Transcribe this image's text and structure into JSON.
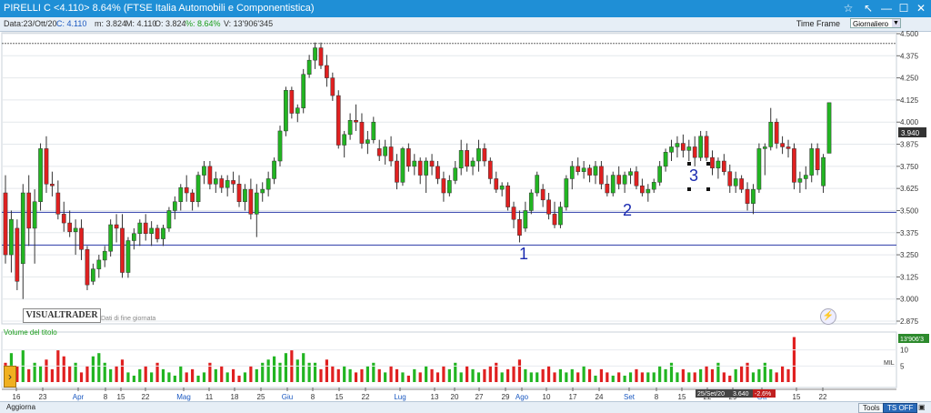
{
  "window": {
    "title": "PIRELLI C <4.110> 8.64%  (FTSE Italia Automobili e Componentistica)",
    "controls": [
      "☆",
      "↖",
      "—",
      "☐",
      "✕"
    ]
  },
  "infobar": {
    "date": "Data:23/Ott/20",
    "close": "C: 4.110",
    "min": "m: 3.824",
    "max": "M: 4.110",
    "open": "O: 3.824",
    "pct": "%: 8.64%",
    "volume": "V: 13'906'345"
  },
  "timeframe": {
    "label": "Time Frame",
    "value": "Giornaliero"
  },
  "logo": {
    "text": "VISUALTRADER",
    "subtitle": "Dati di fine giornata"
  },
  "price_tag": "3.940",
  "volume_tag": "13'906'3",
  "annotations": {
    "n1": "1",
    "n2": "2",
    "n3": "3"
  },
  "tooltip": {
    "date": "25/Set/20",
    "value": "3.640",
    "pct": "-2.6%"
  },
  "bottom": {
    "update_label": "Aggiorna",
    "tools_label": "Tools",
    "tsoff_label": "TS OFF"
  },
  "volume_panel": {
    "title": "Volume del titolo",
    "unit": "MIL"
  },
  "colors": {
    "up": "#22b522",
    "down": "#e02020",
    "title_bg": "#1f8fd6",
    "hline": "#2a3aa8"
  },
  "chart_data": {
    "type": "candlestick",
    "price_axis": {
      "ylim": [
        2.875,
        4.5
      ],
      "ticks": [
        "4.500",
        "4.375",
        "4.250",
        "4.125",
        "4.000",
        "3.875",
        "3.750",
        "3.625",
        "3.500",
        "3.375",
        "3.250",
        "3.125",
        "3.000",
        "2.875"
      ]
    },
    "volume_axis": {
      "ticks": [
        "10",
        "5"
      ]
    },
    "x_ticks": [
      "16",
      "23",
      "Apr",
      "8",
      "15",
      "22",
      "Mag",
      "11",
      "18",
      "25",
      "Giu",
      "8",
      "15",
      "22",
      "Lug",
      "13",
      "20",
      "27",
      "29",
      "Ago",
      "10",
      "17",
      "24",
      "Set",
      "8",
      "15",
      "22",
      "29",
      "Ott",
      "15",
      "22"
    ],
    "hlines": [
      4.445,
      3.49,
      3.305
    ],
    "candles_ohlc": [
      [
        3.6,
        3.7,
        3.2,
        3.25
      ],
      [
        3.25,
        3.5,
        3.15,
        3.45
      ],
      [
        3.4,
        3.45,
        3.05,
        3.1
      ],
      [
        3.2,
        3.65,
        3.0,
        3.6
      ],
      [
        3.6,
        3.7,
        3.3,
        3.4
      ],
      [
        3.4,
        3.62,
        3.2,
        3.55
      ],
      [
        3.55,
        3.88,
        3.5,
        3.85
      ],
      [
        3.85,
        3.92,
        3.6,
        3.65
      ],
      [
        3.65,
        3.72,
        3.58,
        3.64
      ],
      [
        3.6,
        3.67,
        3.45,
        3.48
      ],
      [
        3.48,
        3.55,
        3.38,
        3.43
      ],
      [
        3.43,
        3.5,
        3.35,
        3.38
      ],
      [
        3.38,
        3.45,
        3.25,
        3.4
      ],
      [
        3.4,
        3.45,
        3.22,
        3.28
      ],
      [
        3.28,
        3.3,
        3.05,
        3.08
      ],
      [
        3.1,
        3.2,
        3.08,
        3.17
      ],
      [
        3.17,
        3.25,
        3.12,
        3.22
      ],
      [
        3.22,
        3.3,
        3.18,
        3.27
      ],
      [
        3.27,
        3.45,
        3.24,
        3.42
      ],
      [
        3.42,
        3.48,
        3.32,
        3.4
      ],
      [
        3.4,
        3.48,
        3.12,
        3.15
      ],
      [
        3.15,
        3.35,
        3.12,
        3.33
      ],
      [
        3.33,
        3.4,
        3.28,
        3.37
      ],
      [
        3.37,
        3.45,
        3.3,
        3.43
      ],
      [
        3.43,
        3.48,
        3.33,
        3.37
      ],
      [
        3.37,
        3.44,
        3.3,
        3.4
      ],
      [
        3.4,
        3.42,
        3.32,
        3.34
      ],
      [
        3.34,
        3.42,
        3.3,
        3.4
      ],
      [
        3.4,
        3.52,
        3.38,
        3.5
      ],
      [
        3.5,
        3.58,
        3.45,
        3.55
      ],
      [
        3.55,
        3.65,
        3.5,
        3.63
      ],
      [
        3.63,
        3.7,
        3.55,
        3.6
      ],
      [
        3.6,
        3.62,
        3.5,
        3.55
      ],
      [
        3.55,
        3.72,
        3.52,
        3.7
      ],
      [
        3.7,
        3.78,
        3.65,
        3.75
      ],
      [
        3.75,
        3.78,
        3.62,
        3.65
      ],
      [
        3.65,
        3.72,
        3.6,
        3.68
      ],
      [
        3.68,
        3.7,
        3.6,
        3.63
      ],
      [
        3.63,
        3.7,
        3.58,
        3.67
      ],
      [
        3.67,
        3.72,
        3.6,
        3.65
      ],
      [
        3.65,
        3.7,
        3.52,
        3.55
      ],
      [
        3.55,
        3.65,
        3.5,
        3.62
      ],
      [
        3.62,
        3.68,
        3.45,
        3.48
      ],
      [
        3.48,
        3.65,
        3.35,
        3.6
      ],
      [
        3.6,
        3.66,
        3.55,
        3.62
      ],
      [
        3.62,
        3.72,
        3.58,
        3.68
      ],
      [
        3.68,
        3.8,
        3.65,
        3.78
      ],
      [
        3.78,
        3.98,
        3.75,
        3.95
      ],
      [
        3.95,
        4.2,
        3.92,
        4.18
      ],
      [
        4.18,
        4.2,
        4.02,
        4.05
      ],
      [
        4.05,
        4.1,
        4.0,
        4.08
      ],
      [
        4.08,
        4.3,
        4.05,
        4.27
      ],
      [
        4.27,
        4.38,
        4.25,
        4.35
      ],
      [
        4.35,
        4.45,
        4.3,
        4.42
      ],
      [
        4.42,
        4.45,
        4.3,
        4.32
      ],
      [
        4.32,
        4.38,
        4.2,
        4.25
      ],
      [
        4.25,
        4.28,
        4.12,
        4.15
      ],
      [
        4.15,
        4.18,
        3.85,
        3.87
      ],
      [
        3.87,
        3.95,
        3.8,
        3.93
      ],
      [
        3.93,
        4.05,
        3.9,
        4.01
      ],
      [
        4.01,
        4.1,
        3.95,
        4.0
      ],
      [
        4.0,
        4.05,
        3.85,
        3.88
      ],
      [
        3.88,
        3.95,
        3.82,
        3.9
      ],
      [
        3.9,
        4.03,
        3.88,
        4.0
      ],
      [
        3.85,
        3.9,
        3.78,
        3.81
      ],
      [
        3.81,
        3.9,
        3.76,
        3.86
      ],
      [
        3.86,
        3.92,
        3.75,
        3.78
      ],
      [
        3.78,
        3.82,
        3.62,
        3.66
      ],
      [
        3.66,
        3.86,
        3.64,
        3.85
      ],
      [
        3.85,
        3.88,
        3.72,
        3.75
      ],
      [
        3.75,
        3.82,
        3.7,
        3.78
      ],
      [
        3.78,
        3.8,
        3.65,
        3.7
      ],
      [
        3.7,
        3.8,
        3.6,
        3.78
      ],
      [
        3.78,
        3.82,
        3.7,
        3.75
      ],
      [
        3.75,
        3.78,
        3.65,
        3.68
      ],
      [
        3.68,
        3.72,
        3.55,
        3.6
      ],
      [
        3.6,
        3.7,
        3.58,
        3.67
      ],
      [
        3.67,
        3.78,
        3.65,
        3.74
      ],
      [
        3.74,
        3.9,
        3.7,
        3.84
      ],
      [
        3.84,
        3.88,
        3.72,
        3.75
      ],
      [
        3.75,
        3.8,
        3.7,
        3.78
      ],
      [
        3.78,
        3.9,
        3.72,
        3.85
      ],
      [
        3.85,
        3.88,
        3.75,
        3.78
      ],
      [
        3.78,
        3.8,
        3.65,
        3.68
      ],
      [
        3.68,
        3.72,
        3.6,
        3.62
      ],
      [
        3.62,
        3.66,
        3.58,
        3.64
      ],
      [
        3.64,
        3.66,
        3.5,
        3.52
      ],
      [
        3.52,
        3.55,
        3.4,
        3.45
      ],
      [
        3.45,
        3.5,
        3.32,
        3.36
      ],
      [
        3.4,
        3.55,
        3.38,
        3.5
      ],
      [
        3.5,
        3.62,
        3.48,
        3.6
      ],
      [
        3.6,
        3.72,
        3.58,
        3.7
      ],
      [
        3.62,
        3.65,
        3.52,
        3.56
      ],
      [
        3.56,
        3.6,
        3.45,
        3.48
      ],
      [
        3.48,
        3.55,
        3.4,
        3.42
      ],
      [
        3.42,
        3.55,
        3.4,
        3.52
      ],
      [
        3.52,
        3.7,
        3.5,
        3.68
      ],
      [
        3.68,
        3.78,
        3.62,
        3.75
      ],
      [
        3.75,
        3.8,
        3.7,
        3.72
      ],
      [
        3.72,
        3.78,
        3.68,
        3.74
      ],
      [
        3.74,
        3.76,
        3.66,
        3.7
      ],
      [
        3.7,
        3.78,
        3.65,
        3.75
      ],
      [
        3.75,
        3.78,
        3.62,
        3.65
      ],
      [
        3.65,
        3.7,
        3.58,
        3.6
      ],
      [
        3.6,
        3.72,
        3.58,
        3.7
      ],
      [
        3.7,
        3.75,
        3.62,
        3.65
      ],
      [
        3.65,
        3.72,
        3.6,
        3.7
      ],
      [
        3.7,
        3.74,
        3.65,
        3.72
      ],
      [
        3.72,
        3.75,
        3.62,
        3.64
      ],
      [
        3.64,
        3.68,
        3.58,
        3.6
      ],
      [
        3.6,
        3.65,
        3.55,
        3.62
      ],
      [
        3.62,
        3.68,
        3.6,
        3.66
      ],
      [
        3.66,
        3.78,
        3.64,
        3.75
      ],
      [
        3.75,
        3.85,
        3.72,
        3.83
      ],
      [
        3.83,
        3.9,
        3.78,
        3.86
      ],
      [
        3.86,
        3.92,
        3.8,
        3.88
      ],
      [
        3.88,
        3.93,
        3.8,
        3.84
      ],
      [
        3.84,
        3.9,
        3.78,
        3.86
      ],
      [
        3.86,
        3.92,
        3.75,
        3.8
      ],
      [
        3.8,
        3.95,
        3.78,
        3.92
      ],
      [
        3.92,
        3.95,
        3.78,
        3.8
      ],
      [
        3.8,
        3.84,
        3.7,
        3.74
      ],
      [
        3.74,
        3.8,
        3.68,
        3.78
      ],
      [
        3.78,
        3.82,
        3.7,
        3.72
      ],
      [
        3.72,
        3.76,
        3.6,
        3.64
      ],
      [
        3.64,
        3.72,
        3.6,
        3.68
      ],
      [
        3.68,
        3.7,
        3.6,
        3.62
      ],
      [
        3.62,
        3.66,
        3.5,
        3.54
      ],
      [
        3.54,
        3.65,
        3.48,
        3.62
      ],
      [
        3.62,
        3.88,
        3.6,
        3.85
      ],
      [
        3.85,
        3.88,
        3.7,
        3.86
      ],
      [
        3.86,
        4.08,
        3.84,
        4.0
      ],
      [
        4.0,
        4.02,
        3.85,
        3.88
      ],
      [
        3.88,
        3.92,
        3.82,
        3.86
      ],
      [
        3.86,
        3.9,
        3.8,
        3.85
      ],
      [
        3.85,
        3.88,
        3.62,
        3.66
      ],
      [
        3.66,
        3.72,
        3.6,
        3.68
      ],
      [
        3.68,
        3.75,
        3.62,
        3.7
      ],
      [
        3.7,
        3.88,
        3.66,
        3.85
      ],
      [
        3.85,
        3.88,
        3.7,
        3.73
      ],
      [
        3.64,
        3.82,
        3.6,
        3.8
      ],
      [
        3.824,
        4.11,
        3.824,
        4.11
      ]
    ],
    "volumes": [
      6,
      9,
      5,
      10,
      4,
      6,
      5,
      7,
      4,
      10,
      8,
      5,
      6,
      3,
      5,
      8,
      9,
      6,
      4,
      5,
      7,
      3,
      2,
      4,
      5,
      3,
      6,
      4,
      3,
      2,
      5,
      3,
      4,
      2,
      3,
      6,
      4,
      5,
      3,
      4,
      2,
      3,
      5,
      4,
      6,
      7,
      8,
      6,
      9,
      10,
      7,
      9,
      6,
      6,
      4,
      7,
      5,
      4,
      5,
      4,
      3,
      4,
      5,
      6,
      4,
      3,
      5,
      4,
      3,
      2,
      4,
      3,
      5,
      4,
      3,
      5,
      4,
      6,
      3,
      5,
      4,
      3,
      4,
      5,
      6,
      3,
      4,
      5,
      7,
      4,
      3,
      3,
      4,
      5,
      3,
      4,
      3,
      4,
      3,
      5,
      4,
      2,
      4,
      3,
      2,
      3,
      2,
      3,
      4,
      3,
      3,
      3,
      5,
      4,
      6,
      3,
      4,
      3,
      3,
      4,
      5,
      4,
      6,
      3,
      2,
      4,
      5,
      6,
      3,
      4,
      6,
      4,
      3,
      5,
      4,
      14
    ]
  }
}
